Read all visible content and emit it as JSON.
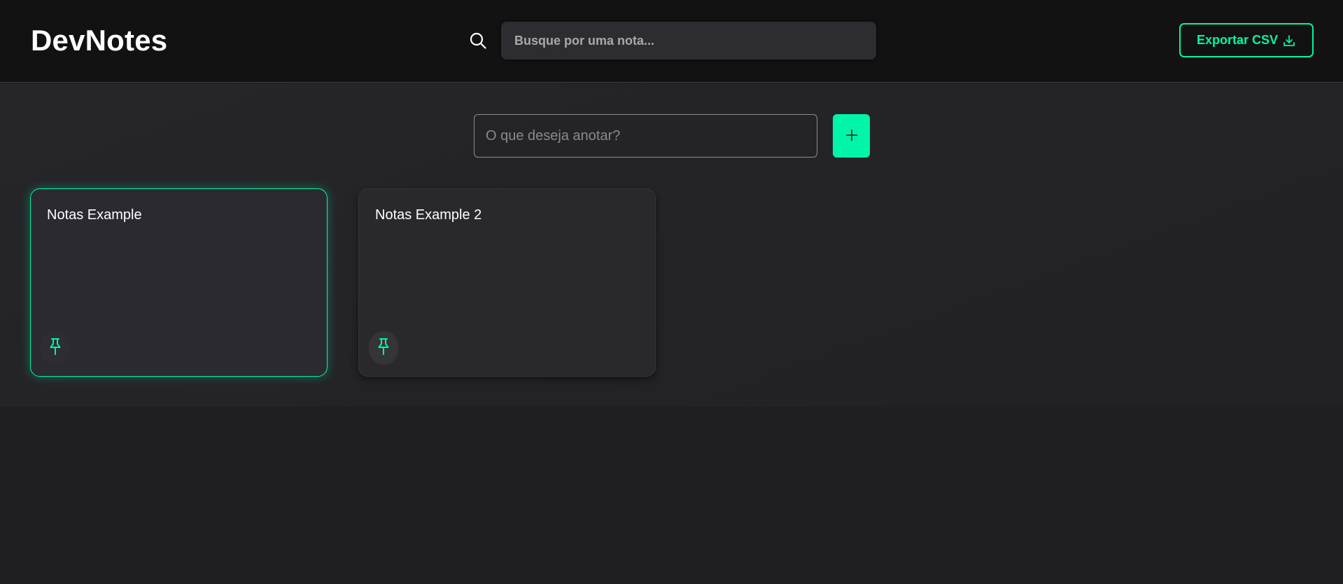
{
  "header": {
    "logo": "DevNotes",
    "search_placeholder": "Busque por uma nota...",
    "export_label": "Exportar CSV",
    "export_icon": "download-icon",
    "search_icon": "search-icon"
  },
  "composer": {
    "placeholder": "O que deseja anotar?",
    "add_icon": "plus-icon"
  },
  "notes": [
    {
      "title": "Notas Example",
      "pinned": true,
      "pin_icon": "pin-icon"
    },
    {
      "title": "Notas Example 2",
      "pinned": false,
      "pin_icon": "pin-icon"
    }
  ],
  "colors": {
    "accent": "#00f5a8",
    "header_bg": "#121212",
    "page_bg": "#1f1f22",
    "card_bg": "#2a2a2e"
  }
}
